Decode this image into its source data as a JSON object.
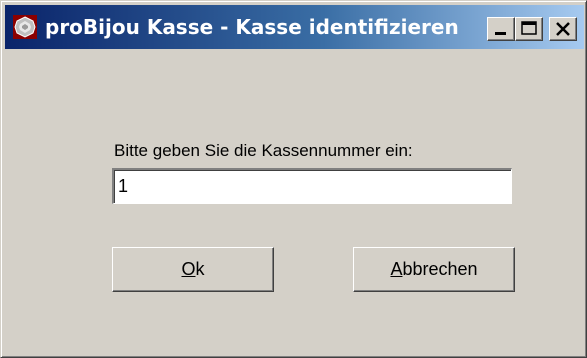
{
  "window": {
    "title": "proBijou Kasse - Kasse identifizieren"
  },
  "titlebar_buttons": {
    "minimize": "minimize-icon",
    "maximize": "maximize-icon",
    "close": "close-icon"
  },
  "form": {
    "prompt": "Bitte geben Sie die Kassennummer ein:",
    "register_number_value": "1"
  },
  "buttons": {
    "ok_mnemonic": "O",
    "ok_rest": "k",
    "cancel_mnemonic": "A",
    "cancel_rest": "bbrechen"
  },
  "colors": {
    "titlebar_start": "#0a246a",
    "titlebar_end": "#a6caf0",
    "face": "#d4d0c8"
  }
}
